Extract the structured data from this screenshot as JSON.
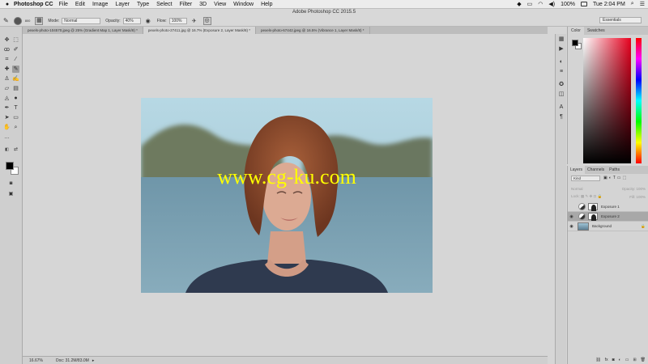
{
  "menubar": {
    "apple": "",
    "app_name": "Photoshop CC",
    "menus": [
      "File",
      "Edit",
      "Image",
      "Layer",
      "Type",
      "Select",
      "Filter",
      "3D",
      "View",
      "Window",
      "Help"
    ],
    "battery": "100%",
    "clock": "Tue 2:04 PM"
  },
  "optionsbar": {
    "window_title": "Adobe Photoshop CC 2015.5",
    "brush_size": "800",
    "mode_label": "Mode:",
    "mode_value": "Normal",
    "opacity_label": "Opacity:",
    "opacity_value": "40%",
    "flow_label": "Flow:",
    "flow_value": "100%",
    "workspace": "Essentials"
  },
  "tabs": [
    {
      "label": "pexels-photo-104570.jpeg @ 25% (Gradient Map 1, Layer Mask/8) *",
      "active": false
    },
    {
      "label": "pexels-photo-27411.jpg @ 16.7% (Exposure 2, Layer Mask/8) *",
      "active": true
    },
    {
      "label": "pexels-photo-67442.jpeg @ 16.5% (Vibrance 1, Layer Mask/8) *",
      "active": false
    }
  ],
  "canvas": {
    "watermark": "www.cg-ku.com",
    "colors": {
      "sky": "#a9cfdc",
      "hills": "#6d7a5c",
      "water": "#6e93a6",
      "hair": "#8a4a2c",
      "skin": "#d9a58f",
      "shirt": "#2f3a4f"
    }
  },
  "statusbar": {
    "zoom": "16.67%",
    "doc": "Doc: 31.2M/83.0M"
  },
  "colorpanel": {
    "tabs": [
      "Color",
      "Swatches"
    ]
  },
  "layers": {
    "tabs": [
      "Layers",
      "Channels",
      "Paths"
    ],
    "filter": "Kind",
    "blend_mode": "Normal",
    "opacity_label": "Opacity:",
    "opacity_value": "100%",
    "lock_label": "Lock:",
    "fill_label": "Fill:",
    "fill_value": "100%",
    "items": [
      {
        "name": "Exposure 1",
        "visible": false,
        "selected": false
      },
      {
        "name": "Exposure 2",
        "visible": true,
        "selected": true
      },
      {
        "name": "Background",
        "visible": true,
        "selected": false
      }
    ]
  }
}
